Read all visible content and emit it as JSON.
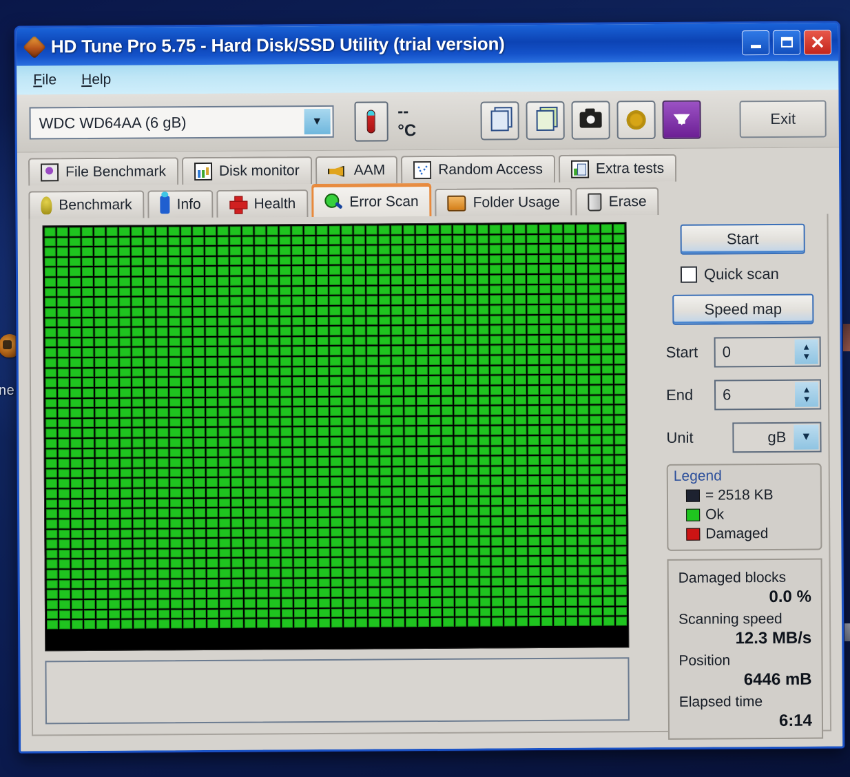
{
  "window": {
    "title": "HD Tune Pro 5.75 - Hard Disk/SSD Utility (trial version)",
    "app_icon": "diamond-app-icon",
    "minimize_label": "Minimize",
    "maximize_label": "Maximize",
    "close_label": "Close"
  },
  "menu": {
    "items": [
      {
        "label": "File",
        "accel": "F"
      },
      {
        "label": "Help",
        "accel": "H"
      }
    ]
  },
  "toolbar": {
    "drive": "WDC WD64AA (6 gB)",
    "drive_dropdown_icon": "chevron-down-icon",
    "temperature": "-- °C",
    "thermometer_icon": "thermometer-icon",
    "buttons": [
      {
        "icon": "copy-icon",
        "label": "Copy"
      },
      {
        "icon": "copy-colored-icon",
        "label": "Copy image"
      },
      {
        "icon": "camera-icon",
        "label": "Screenshot"
      },
      {
        "icon": "gear-icon",
        "label": "Options"
      }
    ],
    "download_icon": "download-arrow-icon",
    "exit_label": "Exit"
  },
  "tabs": {
    "row1": [
      {
        "label": "File Benchmark",
        "icon": "file-benchmark-icon",
        "active": false
      },
      {
        "label": "Disk monitor",
        "icon": "bar-chart-icon",
        "active": false
      },
      {
        "label": "AAM",
        "icon": "speaker-icon",
        "active": false
      },
      {
        "label": "Random Access",
        "icon": "scatter-dots-icon",
        "active": false
      },
      {
        "label": "Extra tests",
        "icon": "extra-tests-icon",
        "active": false
      }
    ],
    "row2": [
      {
        "label": "Benchmark",
        "icon": "lightbulb-icon",
        "active": false
      },
      {
        "label": "Info",
        "icon": "info-icon",
        "active": false
      },
      {
        "label": "Health",
        "icon": "red-cross-icon",
        "active": false
      },
      {
        "label": "Error Scan",
        "icon": "magnifier-icon",
        "active": true
      },
      {
        "label": "Folder Usage",
        "icon": "folder-icon",
        "active": false
      },
      {
        "label": "Erase",
        "icon": "trash-icon",
        "active": false
      }
    ]
  },
  "controls": {
    "start_label": "Start",
    "quick_scan_label": "Quick scan",
    "quick_scan_checked": false,
    "speed_map_label": "Speed map",
    "start_field": {
      "label": "Start",
      "value": "0"
    },
    "end_field": {
      "label": "End",
      "value": "6"
    },
    "unit_field": {
      "label": "Unit",
      "value": "gB",
      "dropdown_icon": "chevron-down-icon"
    }
  },
  "legend": {
    "title": "Legend",
    "block_size": "= 2518 KB",
    "ok_label": "Ok",
    "damaged_label": "Damaged",
    "colors": {
      "ok": "#1fc41f",
      "damaged": "#cc1414",
      "block": "#1d2230"
    }
  },
  "stats": {
    "damaged_blocks_label": "Damaged blocks",
    "damaged_blocks_value": "0.0 %",
    "scanning_speed_label": "Scanning speed",
    "scanning_speed_value": "12.3 MB/s",
    "position_label": "Position",
    "position_value": "6446 mB",
    "elapsed_time_label": "Elapsed time",
    "elapsed_time_value": "6:14"
  },
  "map": {
    "columns": 47,
    "rows": 42,
    "scanned_blocks": 1880,
    "total_blocks": 1974
  },
  "desktop": {
    "icon_label": "ne",
    "icon_name": "desktop-shortcut-icon"
  }
}
